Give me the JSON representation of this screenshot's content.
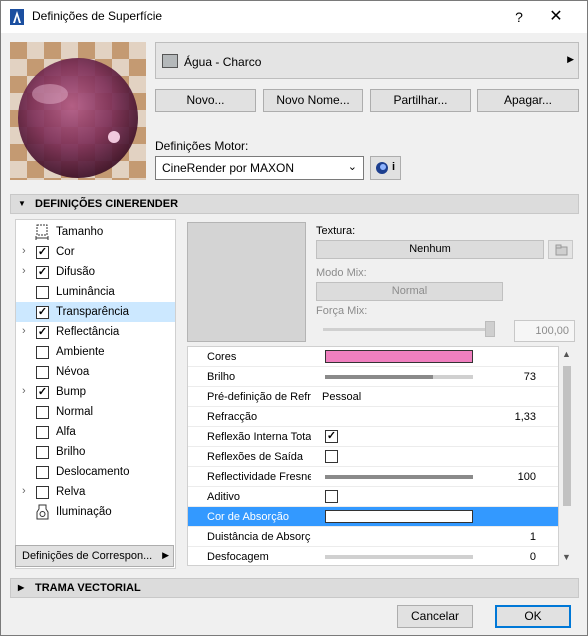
{
  "window": {
    "title": "Definições de Superfície",
    "help": "?",
    "close": "✕"
  },
  "material": {
    "name": "Água - Charco",
    "swatch_color": "#b4b8ba"
  },
  "actions": {
    "new": "Novo...",
    "new_name": "Novo Nome...",
    "share": "Partilhar...",
    "delete": "Apagar..."
  },
  "engine": {
    "label": "Definições Motor:",
    "value": "CineRender por MAXON",
    "info": "i"
  },
  "section_cinerender": "DEFINIÇÕES CINERENDER",
  "section_vector": "TRAMA VECTORIAL",
  "channels": [
    {
      "label": "Tamanho",
      "expand": false,
      "type": "icon",
      "icon": "size-icon"
    },
    {
      "label": "Cor",
      "expand": true,
      "type": "checkbox",
      "checked": true
    },
    {
      "label": "Difusão",
      "expand": true,
      "type": "checkbox",
      "checked": true
    },
    {
      "label": "Luminância",
      "expand": false,
      "type": "checkbox",
      "checked": false
    },
    {
      "label": "Transparência",
      "expand": false,
      "type": "checkbox",
      "checked": true,
      "selected": true
    },
    {
      "label": "Reflectância",
      "expand": true,
      "type": "checkbox",
      "checked": true
    },
    {
      "label": "Ambiente",
      "expand": false,
      "type": "checkbox",
      "checked": false
    },
    {
      "label": "Névoa",
      "expand": false,
      "type": "checkbox",
      "checked": false
    },
    {
      "label": "Bump",
      "expand": true,
      "type": "checkbox",
      "checked": true
    },
    {
      "label": "Normal",
      "expand": false,
      "type": "checkbox",
      "checked": false
    },
    {
      "label": "Alfa",
      "expand": false,
      "type": "checkbox",
      "checked": false
    },
    {
      "label": "Brilho",
      "expand": false,
      "type": "checkbox",
      "checked": false
    },
    {
      "label": "Deslocamento",
      "expand": false,
      "type": "checkbox",
      "checked": false
    },
    {
      "label": "Relva",
      "expand": true,
      "type": "checkbox",
      "checked": false
    },
    {
      "label": "Iluminação",
      "expand": false,
      "type": "icon",
      "icon": "lighting-icon"
    }
  ],
  "correspondence_button": "Definições de Correspon...",
  "texture": {
    "label": "Textura:",
    "value": "Nenhum",
    "mix_mode_label": "Modo Mix:",
    "mix_mode_value": "Normal",
    "mix_strength_label": "Força Mix:",
    "mix_strength_value": "100,00"
  },
  "properties": [
    {
      "name": "Cores",
      "kind": "color",
      "color": "#f07fbf"
    },
    {
      "name": "Brilho",
      "kind": "slider",
      "level": 0.73,
      "value": "73"
    },
    {
      "name": "Pré-definição de Refracção",
      "kind": "text",
      "value": "Pessoal"
    },
    {
      "name": "Refracção",
      "kind": "number",
      "value": "1,33"
    },
    {
      "name": "Reflexão Interna Total",
      "kind": "check",
      "checked": true
    },
    {
      "name": "Reflexões de Saída",
      "kind": "check",
      "checked": false
    },
    {
      "name": "Reflectividade Fresnel",
      "kind": "slider",
      "level": 1.0,
      "value": "100"
    },
    {
      "name": "Aditivo",
      "kind": "check",
      "checked": false
    },
    {
      "name": "Cor de Absorção",
      "kind": "color",
      "color": "#ffffff",
      "selected": true
    },
    {
      "name": "Duistância de Absorção",
      "kind": "number",
      "value": "1"
    },
    {
      "name": "Desfocagem",
      "kind": "slider",
      "level": 0.0,
      "value": "0"
    }
  ],
  "buttons": {
    "cancel": "Cancelar",
    "ok": "OK"
  }
}
